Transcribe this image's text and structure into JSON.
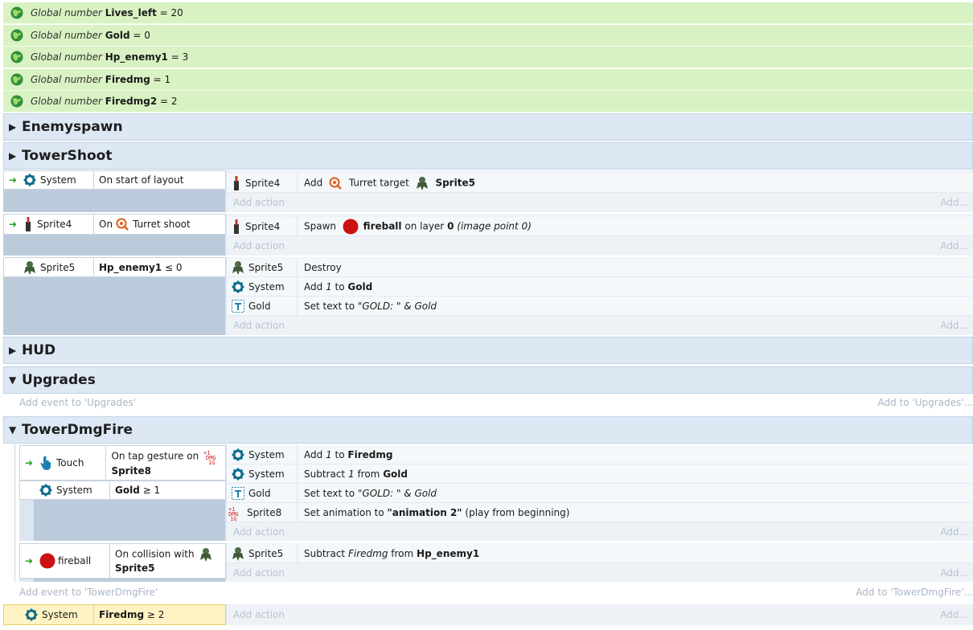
{
  "globals": [
    {
      "kw": "Global number",
      "name": "Lives_left",
      "eq": "= 20"
    },
    {
      "kw": "Global number",
      "name": "Gold",
      "eq": "= 0"
    },
    {
      "kw": "Global number",
      "name": "Hp_enemy1",
      "eq": "= 3"
    },
    {
      "kw": "Global number",
      "name": "Firedmg",
      "eq": "= 1"
    },
    {
      "kw": "Global number",
      "name": "Firedmg2",
      "eq": "= 2"
    }
  ],
  "groups": {
    "enemyspawn": "Enemyspawn",
    "towershoot": "TowerShoot",
    "hud": "HUD",
    "upgrades": "Upgrades",
    "towerdmgfire": "TowerDmgFire"
  },
  "ev1": {
    "cond_obj": "System",
    "cond_desc": "On start of layout",
    "act_obj": "Sprite4",
    "act_add": "Add",
    "act_beh": "Turret target",
    "act_target": "Sprite5"
  },
  "ev2": {
    "cond_obj": "Sprite4",
    "cond_on": "On",
    "cond_desc": "Turret shoot",
    "act_obj": "Sprite4",
    "act_spawn": "Spawn",
    "act_fireball": "fireball",
    "act_onlayer": "on layer",
    "act_layer": "0",
    "act_ip": "(image point 0)"
  },
  "ev3": {
    "cond_obj": "Sprite5",
    "cond_var": "Hp_enemy1",
    "cond_op": "≤ 0",
    "a1_obj": "Sprite5",
    "a1_desc": "Destroy",
    "a2_obj": "System",
    "a2_add": "Add",
    "a2_val": "1",
    "a2_to": "to",
    "a2_var": "Gold",
    "a3_obj": "Gold",
    "a3_pre": "Set text to",
    "a3_val": "\"GOLD: \" & Gold"
  },
  "common": {
    "add_action": "Add action",
    "add_short": "Add..."
  },
  "upgrades": {
    "add_event": "Add event to 'Upgrades'",
    "add_to": "Add to 'Upgrades'..."
  },
  "ev4": {
    "c1_obj": "Touch",
    "c1_desc": "On tap gesture on",
    "c1_target": "Sprite8",
    "c2_obj": "System",
    "c2_var": "Gold",
    "c2_op": "≥ 1",
    "a1_obj": "System",
    "a1_add": "Add",
    "a1_val": "1",
    "a1_to": "to",
    "a1_var": "Firedmg",
    "a2_obj": "System",
    "a2_sub": "Subtract",
    "a2_val": "1",
    "a2_from": "from",
    "a2_var": "Gold",
    "a3_obj": "Gold",
    "a3_pre": "Set text to",
    "a3_val": "\"GOLD: \" & Gold",
    "a4_obj": "Sprite8",
    "a4_pre": "Set animation to",
    "a4_val": "\"animation 2\"",
    "a4_post": "(play from beginning)"
  },
  "ev5": {
    "c1_obj": "fireball",
    "c1_desc": "On collision with",
    "c1_target": "Sprite5",
    "a1_obj": "Sprite5",
    "a1_sub": "Subtract",
    "a1_val": "Firedmg",
    "a1_from": "from",
    "a1_var": "Hp_enemy1"
  },
  "towerdmgfire": {
    "add_event": "Add event to 'TowerDmgFire'",
    "add_to": "Add to 'TowerDmgFire'..."
  },
  "ev6": {
    "cond_obj": "System",
    "cond_var": "Firedmg",
    "cond_op": "≥ 2"
  },
  "colors": {
    "global_bg": "#d9f2c3",
    "group_bg": "#dde8f4",
    "condition_block": "#bccbdc",
    "selected": "#fff3c4",
    "fireball": "#cc1111"
  }
}
